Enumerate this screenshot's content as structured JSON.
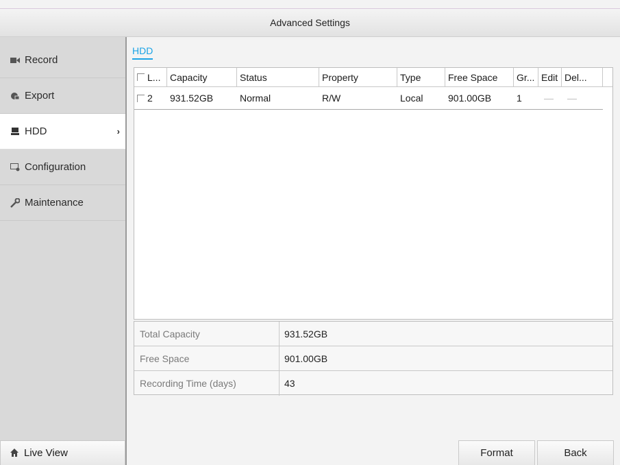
{
  "window": {
    "title": "Advanced Settings"
  },
  "sidebar": {
    "items": [
      {
        "label": "Record",
        "icon": "video-camera-icon"
      },
      {
        "label": "Export",
        "icon": "export-icon"
      },
      {
        "label": "HDD",
        "icon": "hdd-icon",
        "active": true
      },
      {
        "label": "Configuration",
        "icon": "configuration-icon"
      },
      {
        "label": "Maintenance",
        "icon": "wrench-icon"
      }
    ],
    "liveview_label": "Live View"
  },
  "tab": {
    "label": "HDD"
  },
  "table": {
    "headers": [
      "L...",
      "Capacity",
      "Status",
      "Property",
      "Type",
      "Free Space",
      "Gr...",
      "Edit",
      "Del..."
    ],
    "rows": [
      {
        "label": "2",
        "capacity": "931.52GB",
        "status": "Normal",
        "property": "R/W",
        "type": "Local",
        "free_space": "901.00GB",
        "group": "1",
        "edit": "—",
        "delete": "—"
      }
    ]
  },
  "info": {
    "total_capacity_label": "Total Capacity",
    "total_capacity_value": "931.52GB",
    "free_space_label": "Free Space",
    "free_space_value": "901.00GB",
    "recording_time_label": "Recording Time (days)",
    "recording_time_value": "43"
  },
  "buttons": {
    "format": "Format",
    "back": "Back"
  },
  "colors": {
    "accent": "#1aa3e6"
  }
}
